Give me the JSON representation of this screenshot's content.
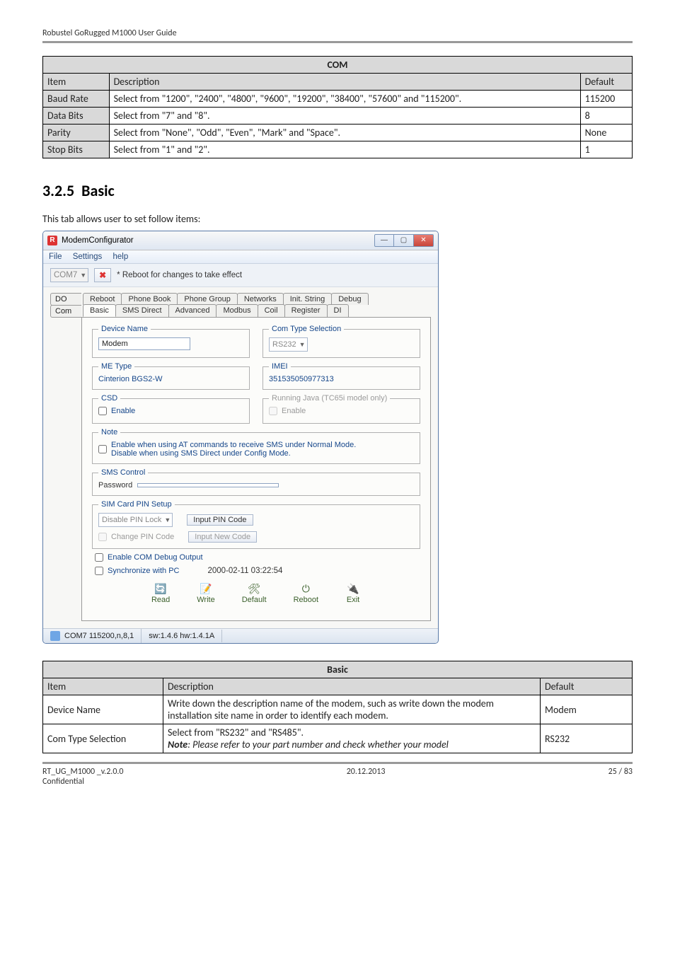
{
  "page_header": "Robustel GoRugged M1000 User Guide",
  "com_table": {
    "title": "COM",
    "headers": [
      "Item",
      "Description",
      "Default"
    ],
    "rows": [
      {
        "item": "Baud Rate",
        "desc": "Select from \"1200\", \"2400\", \"4800\", \"9600\", \"19200\", \"38400\", \"57600\" and \"115200\".",
        "def": "115200"
      },
      {
        "item": "Data Bits",
        "desc": "Select from \"7\" and \"8\".",
        "def": "8"
      },
      {
        "item": "Parity",
        "desc": "Select from \"None\", \"Odd\", \"Even\", \"Mark\" and \"Space\".",
        "def": "None"
      },
      {
        "item": "Stop Bits",
        "desc": "Select from \"1\" and \"2\".",
        "def": "1"
      }
    ]
  },
  "section": {
    "num": "3.2.5",
    "title": "Basic"
  },
  "intro": "This tab allows user to set follow items:",
  "window": {
    "title": "ModemConfigurator",
    "menu": [
      "File",
      "Settings",
      "help"
    ],
    "toolbar": {
      "port": "COM7",
      "hint": "* Reboot for changes to take effect"
    },
    "tabs_top": [
      "Reboot",
      "Phone Book",
      "Phone Group",
      "Networks",
      "Init. String",
      "Debug"
    ],
    "tabs_bottom": [
      "Basic",
      "SMS Direct",
      "Advanced",
      "Modbus",
      "Coil",
      "Register",
      "DI"
    ],
    "tabs_left": [
      "DO",
      "Com"
    ],
    "device_name": {
      "legend": "Device Name",
      "value": "Modem"
    },
    "com_type": {
      "legend": "Com Type Selection",
      "value": "RS232"
    },
    "me_type": {
      "legend": "ME Type",
      "value": "Cinterion BGS2-W"
    },
    "imei": {
      "legend": "IMEI",
      "value": "351535050977313"
    },
    "csd": {
      "legend": "CSD",
      "enable": "Enable"
    },
    "java": {
      "legend": "Running Java (TC65i model only)",
      "enable": "Enable"
    },
    "note": {
      "legend": "Note",
      "text": "Enable when using AT commands to receive SMS under Normal Mode.\nDisable when using SMS Direct under Config Mode."
    },
    "sms_control": {
      "legend": "SMS Control",
      "pw_label": "Password"
    },
    "sim_pin": {
      "legend": "SIM Card PIN Setup",
      "mode": "Disable PIN Lock",
      "change": "Change PIN Code",
      "input_pin": "Input PIN Code",
      "input_new": "Input New Code"
    },
    "debug_chk": "Enable COM Debug Output",
    "sync_chk": "Synchronize with PC",
    "sync_time": "2000-02-11 03:22:54",
    "buttons": [
      "Read",
      "Write",
      "Default",
      "Reboot",
      "Exit"
    ],
    "status": {
      "port": "COM7 115200,n,8,1",
      "ver": "sw:1.4.6 hw:1.4.1A"
    }
  },
  "basic_table": {
    "title": "Basic",
    "headers": [
      "Item",
      "Description",
      "Default"
    ],
    "rows": [
      {
        "item": "Device Name",
        "desc": "Write down the description name of the modem, such as write down the modem installation site name in order to identify each modem.",
        "def": "Modem"
      },
      {
        "item": "Com Type Selection",
        "desc1": "Select from \"RS232\" and \"RS485\".",
        "desc2": "Note: Please refer to your part number and check whether your model",
        "def": "RS232"
      }
    ]
  },
  "footer": {
    "left1": "RT_UG_M1000 _v.2.0.0",
    "left2": "Confidential",
    "center": "20.12.2013",
    "right": "25 / 83"
  }
}
